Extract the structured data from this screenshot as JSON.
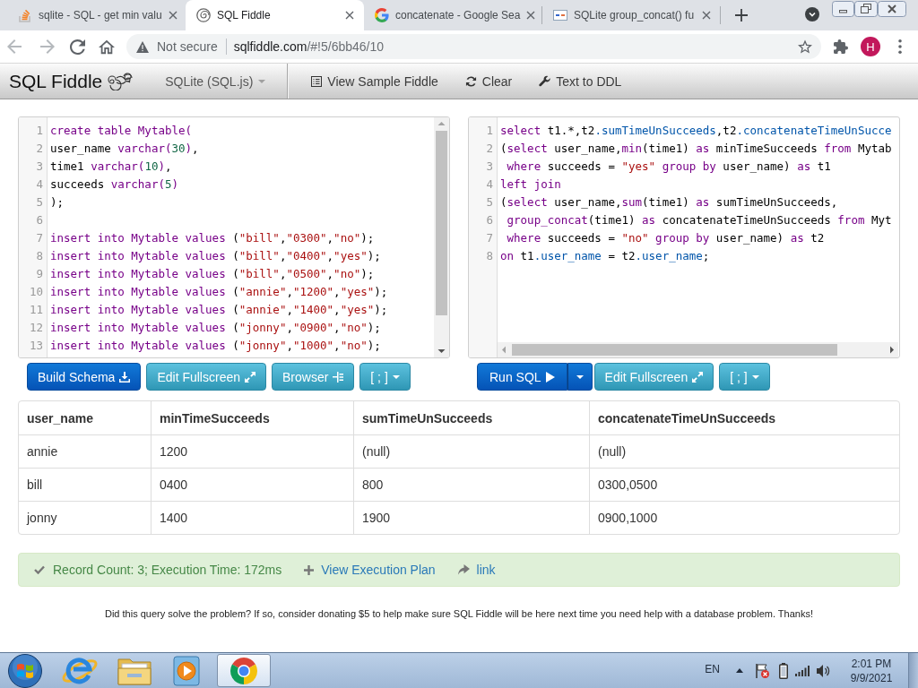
{
  "browser": {
    "tabs": [
      {
        "title": "sqlite - SQL - get min valu",
        "kind": "stack",
        "selected": false
      },
      {
        "title": "SQL Fiddle",
        "kind": "spiral",
        "selected": true
      },
      {
        "title": "concatenate - Google Sea",
        "kind": "google",
        "selected": false
      },
      {
        "title": "SQLite group_concat() fu",
        "kind": "square",
        "selected": false
      }
    ],
    "back": {
      "disabled": true
    },
    "forward": {
      "disabled": true
    },
    "address": {
      "security": "Not secure",
      "host": "sqlfiddle.com",
      "path": "/#!5/6bb46/10"
    },
    "profile": "H"
  },
  "navbar": {
    "brand": "SQL Fiddle",
    "database": "SQLite (SQL.js)",
    "actions": [
      "View Sample Fiddle",
      "Clear",
      "Text to DDL"
    ]
  },
  "schema_editor": {
    "lines": [
      {
        "number": "1",
        "tokens": [
          {
            "kind": "keyword",
            "text": "create table Mytable("
          }
        ]
      },
      {
        "number": "2",
        "tokens": [
          {
            "kind": "plain",
            "text": "user_name "
          },
          {
            "kind": "keyword",
            "text": "varchar("
          },
          {
            "kind": "number",
            "text": "30"
          },
          {
            "kind": "keyword",
            "text": ")"
          },
          {
            "kind": "plain",
            "text": ","
          }
        ]
      },
      {
        "number": "3",
        "tokens": [
          {
            "kind": "plain",
            "text": "time1 "
          },
          {
            "kind": "keyword",
            "text": "varchar("
          },
          {
            "kind": "number",
            "text": "10"
          },
          {
            "kind": "keyword",
            "text": ")"
          },
          {
            "kind": "plain",
            "text": ","
          }
        ]
      },
      {
        "number": "4",
        "tokens": [
          {
            "kind": "plain",
            "text": "succeeds "
          },
          {
            "kind": "keyword",
            "text": "varchar("
          },
          {
            "kind": "number",
            "text": "5"
          },
          {
            "kind": "keyword",
            "text": ")"
          }
        ]
      },
      {
        "number": "5",
        "tokens": [
          {
            "kind": "plain",
            "text": ");"
          }
        ]
      },
      {
        "number": "6"
      },
      {
        "number": "7",
        "tokens": [
          {
            "kind": "keyword",
            "text": "insert into Mytable values "
          },
          {
            "kind": "plain",
            "text": "("
          },
          {
            "kind": "string",
            "text": "\"bill\""
          },
          {
            "kind": "plain",
            "text": ","
          },
          {
            "kind": "string",
            "text": "\"0300\""
          },
          {
            "kind": "plain",
            "text": ","
          },
          {
            "kind": "string",
            "text": "\"no\""
          },
          {
            "kind": "plain",
            "text": ");"
          }
        ]
      },
      {
        "number": "8",
        "tokens": [
          {
            "kind": "keyword",
            "text": "insert into Mytable values "
          },
          {
            "kind": "plain",
            "text": "("
          },
          {
            "kind": "string",
            "text": "\"bill\""
          },
          {
            "kind": "plain",
            "text": ","
          },
          {
            "kind": "string",
            "text": "\"0400\""
          },
          {
            "kind": "plain",
            "text": ","
          },
          {
            "kind": "string",
            "text": "\"yes\""
          },
          {
            "kind": "plain",
            "text": ");"
          }
        ]
      },
      {
        "number": "9",
        "tokens": [
          {
            "kind": "keyword",
            "text": "insert into Mytable values "
          },
          {
            "kind": "plain",
            "text": "("
          },
          {
            "kind": "string",
            "text": "\"bill\""
          },
          {
            "kind": "plain",
            "text": ","
          },
          {
            "kind": "string",
            "text": "\"0500\""
          },
          {
            "kind": "plain",
            "text": ","
          },
          {
            "kind": "string",
            "text": "\"no\""
          },
          {
            "kind": "plain",
            "text": ");"
          }
        ]
      },
      {
        "number": "10",
        "tokens": [
          {
            "kind": "keyword",
            "text": "insert into Mytable values "
          },
          {
            "kind": "plain",
            "text": "("
          },
          {
            "kind": "string",
            "text": "\"annie\""
          },
          {
            "kind": "plain",
            "text": ","
          },
          {
            "kind": "string",
            "text": "\"1200\""
          },
          {
            "kind": "plain",
            "text": ","
          },
          {
            "kind": "string",
            "text": "\"yes\""
          },
          {
            "kind": "plain",
            "text": ");"
          }
        ]
      },
      {
        "number": "11",
        "tokens": [
          {
            "kind": "keyword",
            "text": "insert into Mytable values "
          },
          {
            "kind": "plain",
            "text": "("
          },
          {
            "kind": "string",
            "text": "\"annie\""
          },
          {
            "kind": "plain",
            "text": ","
          },
          {
            "kind": "string",
            "text": "\"1400\""
          },
          {
            "kind": "plain",
            "text": ","
          },
          {
            "kind": "string",
            "text": "\"yes\""
          },
          {
            "kind": "plain",
            "text": ");"
          }
        ]
      },
      {
        "number": "12",
        "tokens": [
          {
            "kind": "keyword",
            "text": "insert into Mytable values "
          },
          {
            "kind": "plain",
            "text": "("
          },
          {
            "kind": "string",
            "text": "\"jonny\""
          },
          {
            "kind": "plain",
            "text": ","
          },
          {
            "kind": "string",
            "text": "\"0900\""
          },
          {
            "kind": "plain",
            "text": ","
          },
          {
            "kind": "string",
            "text": "\"no\""
          },
          {
            "kind": "plain",
            "text": ");"
          }
        ]
      },
      {
        "number": "13",
        "tokens": [
          {
            "kind": "keyword",
            "text": "insert into Mytable values "
          },
          {
            "kind": "plain",
            "text": "("
          },
          {
            "kind": "string",
            "text": "\"jonny\""
          },
          {
            "kind": "plain",
            "text": ","
          },
          {
            "kind": "string",
            "text": "\"1000\""
          },
          {
            "kind": "plain",
            "text": ","
          },
          {
            "kind": "string",
            "text": "\"no\""
          },
          {
            "kind": "plain",
            "text": ");"
          }
        ]
      }
    ]
  },
  "schema_buttons": [
    {
      "label": "Build Schema",
      "kind": "primary"
    },
    {
      "label": "Edit Fullscreen",
      "kind": "info"
    },
    {
      "label": "Browser",
      "kind": "info"
    },
    {
      "label": "[ ; ]",
      "kind": "info"
    }
  ],
  "query_editor": {
    "lines": [
      {
        "number": "1",
        "tokens": [
          {
            "kind": "keyword",
            "text": "select"
          },
          {
            "kind": "plain",
            "text": " t1.*,t2"
          },
          {
            "kind": "property",
            "text": ".sumTimeUnSucceeds"
          },
          {
            "kind": "plain",
            "text": ",t2"
          },
          {
            "kind": "property",
            "text": ".concatenateTimeUnSucce"
          }
        ]
      },
      {
        "number": "2",
        "tokens": [
          {
            "kind": "plain",
            "text": "("
          },
          {
            "kind": "keyword",
            "text": "select"
          },
          {
            "kind": "plain",
            "text": " user_name,"
          },
          {
            "kind": "keyword",
            "text": "min"
          },
          {
            "kind": "plain",
            "text": "(time1) "
          },
          {
            "kind": "keyword",
            "text": "as"
          },
          {
            "kind": "plain",
            "text": " minTimeSucceeds "
          },
          {
            "kind": "keyword",
            "text": "from"
          },
          {
            "kind": "plain",
            "text": " Mytab"
          }
        ]
      },
      {
        "number": "3",
        "tokens": [
          {
            "kind": "keyword",
            "text": " where"
          },
          {
            "kind": "plain",
            "text": " succeeds = "
          },
          {
            "kind": "string",
            "text": "\"yes\""
          },
          {
            "kind": "keyword",
            "text": " group by"
          },
          {
            "kind": "plain",
            "text": " user_name) "
          },
          {
            "kind": "keyword",
            "text": "as"
          },
          {
            "kind": "plain",
            "text": " t1"
          }
        ]
      },
      {
        "number": "4",
        "tokens": [
          {
            "kind": "keyword",
            "text": "left join"
          }
        ]
      },
      {
        "number": "5",
        "tokens": [
          {
            "kind": "plain",
            "text": "("
          },
          {
            "kind": "keyword",
            "text": "select"
          },
          {
            "kind": "plain",
            "text": " user_name,"
          },
          {
            "kind": "keyword",
            "text": "sum"
          },
          {
            "kind": "plain",
            "text": "(time1) "
          },
          {
            "kind": "keyword",
            "text": "as"
          },
          {
            "kind": "plain",
            "text": " sumTimeUnSucceeds,"
          }
        ]
      },
      {
        "number": "6",
        "tokens": [
          {
            "kind": "keyword",
            "text": " group_concat"
          },
          {
            "kind": "plain",
            "text": "(time1) "
          },
          {
            "kind": "keyword",
            "text": "as"
          },
          {
            "kind": "plain",
            "text": " concatenateTimeUnSucceeds "
          },
          {
            "kind": "keyword",
            "text": "from"
          },
          {
            "kind": "plain",
            "text": " Myt"
          }
        ]
      },
      {
        "number": "7",
        "tokens": [
          {
            "kind": "keyword",
            "text": " where"
          },
          {
            "kind": "plain",
            "text": " succeeds = "
          },
          {
            "kind": "string",
            "text": "\"no\""
          },
          {
            "kind": "keyword",
            "text": " group by"
          },
          {
            "kind": "plain",
            "text": " user_name) "
          },
          {
            "kind": "keyword",
            "text": "as"
          },
          {
            "kind": "plain",
            "text": " t2"
          }
        ]
      },
      {
        "number": "8",
        "tokens": [
          {
            "kind": "keyword",
            "text": "on"
          },
          {
            "kind": "plain",
            "text": " t1"
          },
          {
            "kind": "property",
            "text": ".user_name"
          },
          {
            "kind": "plain",
            "text": " = t2"
          },
          {
            "kind": "property",
            "text": ".user_name"
          },
          {
            "kind": "plain",
            "text": ";"
          }
        ]
      }
    ]
  },
  "query_buttons": [
    {
      "label": "Run SQL",
      "kind": "split"
    },
    {
      "label": "Edit Fullscreen",
      "kind": "info"
    },
    {
      "label": "[ ; ]",
      "kind": "info"
    }
  ],
  "results": {
    "columns": [
      "user_name",
      "minTimeSucceeds",
      "sumTimeUnSucceeds",
      "concatenateTimeUnSucceeds"
    ],
    "rows": [
      [
        "annie",
        "1200",
        "(null)",
        "(null)"
      ],
      [
        "bill",
        "0400",
        "800",
        "0300,0500"
      ],
      [
        "jonny",
        "1400",
        "1900",
        "0900,1000"
      ]
    ]
  },
  "status": {
    "summary": "Record Count: 3; Execution Time: 172ms",
    "links": [
      "View Execution Plan",
      "link"
    ]
  },
  "footer": "Did this query solve the problem? If so, consider donating $5 to help make sure SQL Fiddle will be here next time you need help with a database problem. Thanks!",
  "taskbar": {
    "apps": [
      {
        "selected": false
      },
      {
        "selected": false
      },
      {
        "selected": false
      },
      {
        "selected": true
      }
    ],
    "language": "EN",
    "time": "2:01 PM",
    "date": "9/9/2021"
  }
}
